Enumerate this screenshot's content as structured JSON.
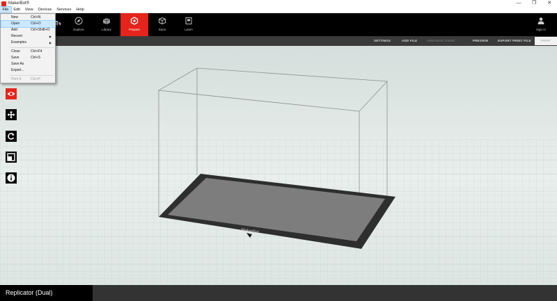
{
  "window": {
    "title": "MakerBot®",
    "minimize": "—",
    "restore": "❐",
    "close": "✕"
  },
  "menubar": [
    "File",
    "Edit",
    "View",
    "Devices",
    "Services",
    "Help"
  ],
  "nav": {
    "items": [
      {
        "label": "Explore",
        "icon": "compass-icon"
      },
      {
        "label": "Library",
        "icon": "cubes-icon"
      },
      {
        "label": "Prepare",
        "icon": "prepare-icon",
        "active": true
      },
      {
        "label": "Store",
        "icon": "box-icon"
      },
      {
        "label": "Learn",
        "icon": "book-icon"
      }
    ],
    "signin": "Sign In"
  },
  "actions": {
    "settings": "SETTINGS",
    "add_file": "ADD FILE",
    "arrange": "ARRANGE ITEMS",
    "preview": "PREVIEW",
    "export": "EXPORT PRINT FILE",
    "print": "PRINT"
  },
  "file_menu": [
    {
      "label": "New",
      "shortcut": "Ctrl+N"
    },
    {
      "label": "Open",
      "shortcut": "Ctrl+O",
      "highlighted": true
    },
    {
      "label": "Add",
      "shortcut": "Ctrl+Shift+O"
    },
    {
      "label": "Recent",
      "submenu": true
    },
    {
      "label": "Examples",
      "submenu": true
    },
    {
      "label": "Close",
      "shortcut": "Ctrl+F4"
    },
    {
      "label": "Save",
      "shortcut": "Ctrl+S"
    },
    {
      "label": "Save As"
    },
    {
      "label": "Export..."
    },
    {
      "label": "Print It",
      "shortcut": "Ctrl+P",
      "disabled": true
    }
  ],
  "build_plate_logo": "MakerBot",
  "printer": {
    "name": "Replicator (Dual)"
  },
  "tools": [
    "eye-icon",
    "move-icon",
    "rotate-icon",
    "scale-icon",
    "info-icon"
  ],
  "colors": {
    "accent": "#e5241b",
    "toolbar": "#000000",
    "actionbar": "#3a3a3a"
  }
}
